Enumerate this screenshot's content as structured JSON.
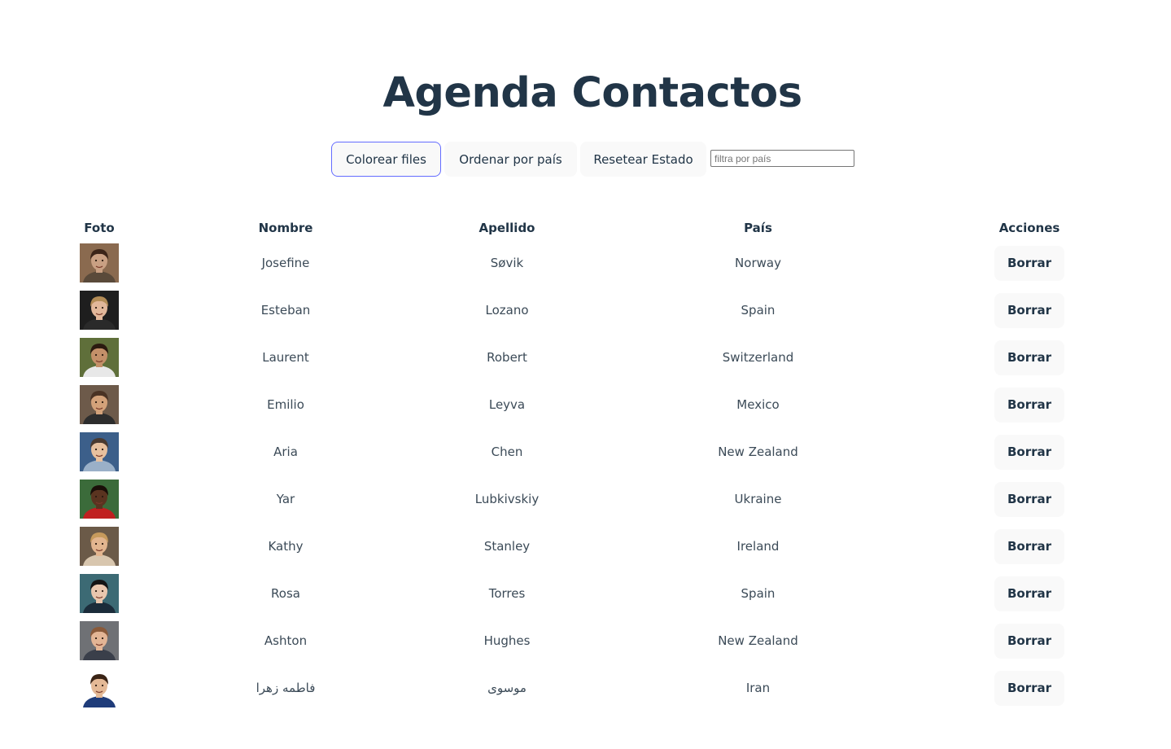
{
  "title": "Agenda Contactos",
  "toolbar": {
    "color_rows_label": "Colorear files",
    "sort_country_label": "Ordenar por país",
    "reset_label": "Resetear Estado",
    "filter_placeholder": "filtra por país"
  },
  "table": {
    "headers": {
      "photo": "Foto",
      "name": "Nombre",
      "last": "Apellido",
      "country": "País",
      "actions": "Acciones"
    },
    "delete_label": "Borrar",
    "rows": [
      {
        "first": "Josefine",
        "last": "Søvik",
        "country": "Norway",
        "skin": "#c9a083",
        "hair": "#3b2418",
        "bg": "#8a6a4f",
        "shirt": "#5a4a3a"
      },
      {
        "first": "Esteban",
        "last": "Lozano",
        "country": "Spain",
        "skin": "#e1b79a",
        "hair": "#b38c56",
        "bg": "#1e1e1e",
        "shirt": "#2a2a2a"
      },
      {
        "first": "Laurent",
        "last": "Robert",
        "country": "Switzerland",
        "skin": "#c39069",
        "hair": "#2b1a10",
        "bg": "#5f6f3a",
        "shirt": "#e8e8e8"
      },
      {
        "first": "Emilio",
        "last": "Leyva",
        "country": "Mexico",
        "skin": "#d3a27a",
        "hair": "#4a3324",
        "bg": "#6d5a4a",
        "shirt": "#2d2d2d"
      },
      {
        "first": "Aria",
        "last": "Chen",
        "country": "New Zealand",
        "skin": "#e7c09e",
        "hair": "#4a3a30",
        "bg": "#3c5f8a",
        "shirt": "#9ab0c8"
      },
      {
        "first": "Yar",
        "last": "Lubkivskiy",
        "country": "Ukraine",
        "skin": "#5a3420",
        "hair": "#1a0e08",
        "bg": "#3b6b3a",
        "shirt": "#c02020"
      },
      {
        "first": "Kathy",
        "last": "Stanley",
        "country": "Ireland",
        "skin": "#e2b58f",
        "hair": "#c69a5c",
        "bg": "#6b5a48",
        "shirt": "#d8c6ae"
      },
      {
        "first": "Rosa",
        "last": "Torres",
        "country": "Spain",
        "skin": "#e9c7ae",
        "hair": "#141414",
        "bg": "#3c6a74",
        "shirt": "#1b2c3a"
      },
      {
        "first": "Ashton",
        "last": "Hughes",
        "country": "New Zealand",
        "skin": "#e3b595",
        "hair": "#8a5a3a",
        "bg": "#6f7175",
        "shirt": "#3a3f4a"
      },
      {
        "first": "فاطمه زهرا",
        "last": "موسوی",
        "country": "Iran",
        "skin": "#e4b996",
        "hair": "#3a2416",
        "bg": "#ffffff",
        "shirt": "#1f3c7a"
      }
    ]
  }
}
